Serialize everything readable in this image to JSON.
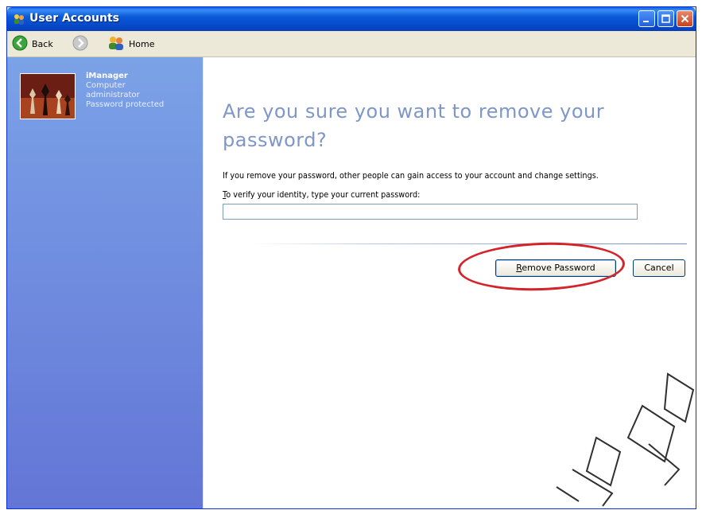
{
  "window": {
    "title": "User Accounts"
  },
  "toolbar": {
    "back_label": "Back",
    "home_label": "Home"
  },
  "user": {
    "name": "iManager",
    "role_line1": "Computer",
    "role_line2": "administrator",
    "status": "Password protected"
  },
  "main": {
    "heading": "Are you sure you want to remove your password?",
    "description": "If you remove your password, other people can gain access to your account and change settings.",
    "prompt_accel": "T",
    "prompt_rest": "o verify your identity, type your current password:",
    "password_value": "",
    "remove_button_accel": "R",
    "remove_button_rest": "emove Password",
    "cancel_label": "Cancel"
  },
  "colors": {
    "titlebar": "#0a5bd8",
    "left_pane_top": "#7ba2e7",
    "left_pane_bottom": "#6375d6",
    "heading": "#7e97c6",
    "annotation": "#d4242a"
  }
}
